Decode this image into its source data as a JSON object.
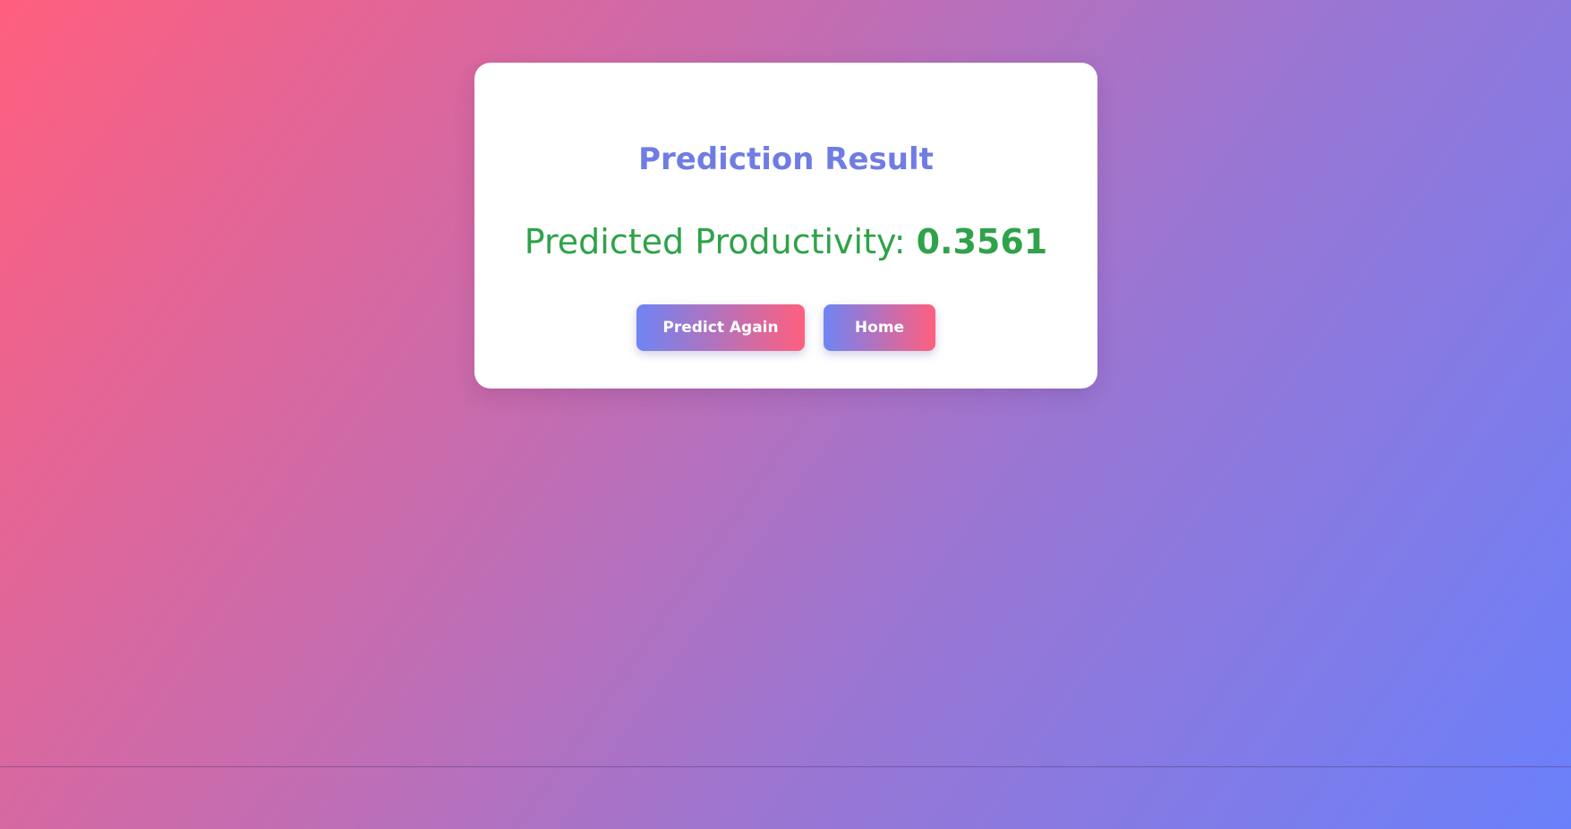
{
  "card": {
    "title": "Prediction Result",
    "result_label": "Predicted Productivity: ",
    "result_value": "0.3561"
  },
  "actions": {
    "predict_again_label": "Predict Again",
    "home_label": "Home"
  },
  "colors": {
    "title": "#6f7de3",
    "result": "#2fa24a",
    "button_gradient_start": "#6f84f4",
    "button_gradient_end": "#ff5f7e",
    "background_start": "#ff5f7e",
    "background_end": "#6a80fa"
  }
}
